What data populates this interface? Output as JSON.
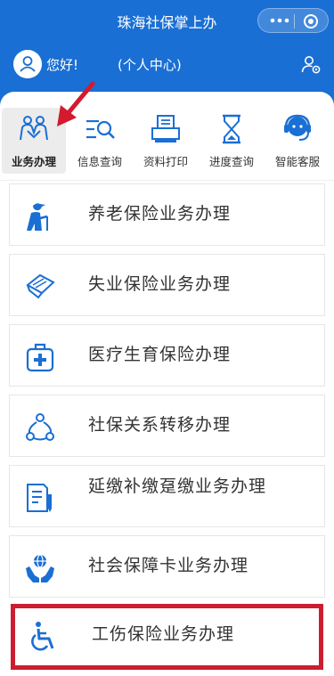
{
  "header": {
    "title": "珠海社保掌上办",
    "more_icon": "more-dots-icon",
    "close_icon": "target-circle-icon",
    "greeting": "您好!",
    "personal_center": "(个人中心)",
    "settings_icon": "user-settings-icon"
  },
  "tabs": [
    {
      "label": "业务办理",
      "icon": "people-handshake-icon",
      "active": true
    },
    {
      "label": "信息查询",
      "icon": "list-search-icon",
      "active": false
    },
    {
      "label": "资料打印",
      "icon": "printer-icon",
      "active": false
    },
    {
      "label": "进度查询",
      "icon": "hourglass-icon",
      "active": false
    },
    {
      "label": "智能客服",
      "icon": "headset-agent-icon",
      "active": false
    }
  ],
  "services": [
    {
      "label": "养老保险业务办理",
      "icon": "elderly-person-icon"
    },
    {
      "label": "失业保险业务办理",
      "icon": "hand-card-icon"
    },
    {
      "label": "医疗生育保险办理",
      "icon": "medical-kit-icon"
    },
    {
      "label": "社保关系转移办理",
      "icon": "people-network-icon"
    },
    {
      "label": "延缴补缴趸缴业务办理",
      "icon": "document-pen-icon"
    },
    {
      "label": "社会保障卡业务办理",
      "icon": "hands-globe-icon"
    },
    {
      "label": "工伤保险业务办理",
      "icon": "wheelchair-icon"
    }
  ],
  "colors": {
    "primary": "#1a6fd4",
    "highlight": "#cc1d31"
  }
}
